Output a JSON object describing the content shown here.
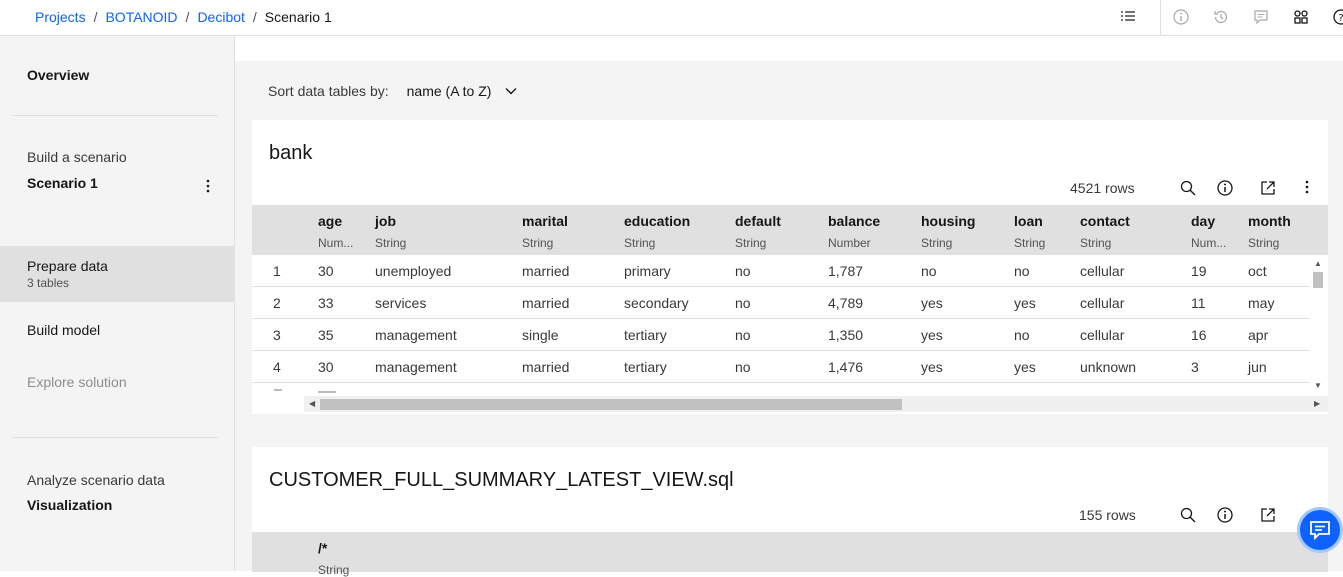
{
  "breadcrumb": {
    "items": [
      "Projects",
      "BOTANOID",
      "Decibot"
    ],
    "current": "Scenario 1",
    "separator": "/"
  },
  "sidebar": {
    "overview": "Overview",
    "build_scenario": "Build a scenario",
    "scenario_name": "Scenario 1",
    "prepare_data": "Prepare data",
    "prepare_data_sub": "3 tables",
    "build_model": "Build model",
    "explore_solution": "Explore solution",
    "analyze": "Analyze scenario data",
    "visualization": "Visualization"
  },
  "sort": {
    "label": "Sort data tables by:",
    "value": "name (A to Z)"
  },
  "tables": [
    {
      "title": "bank",
      "rows_label": "4521 rows",
      "columns": [
        {
          "name": "age",
          "type": "Num..."
        },
        {
          "name": "job",
          "type": "String"
        },
        {
          "name": "marital",
          "type": "String"
        },
        {
          "name": "education",
          "type": "String"
        },
        {
          "name": "default",
          "type": "String"
        },
        {
          "name": "balance",
          "type": "Number"
        },
        {
          "name": "housing",
          "type": "String"
        },
        {
          "name": "loan",
          "type": "String"
        },
        {
          "name": "contact",
          "type": "String"
        },
        {
          "name": "day",
          "type": "Num..."
        },
        {
          "name": "month",
          "type": "String"
        }
      ],
      "rows": [
        [
          "1",
          "30",
          "unemployed",
          "married",
          "primary",
          "no",
          "1,787",
          "no",
          "no",
          "cellular",
          "19",
          "oct"
        ],
        [
          "2",
          "33",
          "services",
          "married",
          "secondary",
          "no",
          "4,789",
          "yes",
          "yes",
          "cellular",
          "11",
          "may"
        ],
        [
          "3",
          "35",
          "management",
          "single",
          "tertiary",
          "no",
          "1,350",
          "yes",
          "no",
          "cellular",
          "16",
          "apr"
        ],
        [
          "4",
          "30",
          "management",
          "married",
          "tertiary",
          "no",
          "1,476",
          "yes",
          "yes",
          "unknown",
          "3",
          "jun"
        ]
      ]
    },
    {
      "title": "CUSTOMER_FULL_SUMMARY_LATEST_VIEW.sql",
      "rows_label": "155 rows",
      "columns": [
        {
          "name": "/*",
          "type": "String"
        }
      ]
    }
  ],
  "colors": {
    "link": "#0f62fe",
    "sidebar_bg": "#f4f4f4",
    "header_bg": "#e0e0e0",
    "chat": "#0f62fe"
  },
  "icons": [
    "list-icon",
    "info-icon",
    "history-icon",
    "comment-icon",
    "apps-icon",
    "help-icon",
    "overflow-menu-icon",
    "chevron-down-icon",
    "search-icon",
    "launch-icon",
    "chat-icon"
  ]
}
